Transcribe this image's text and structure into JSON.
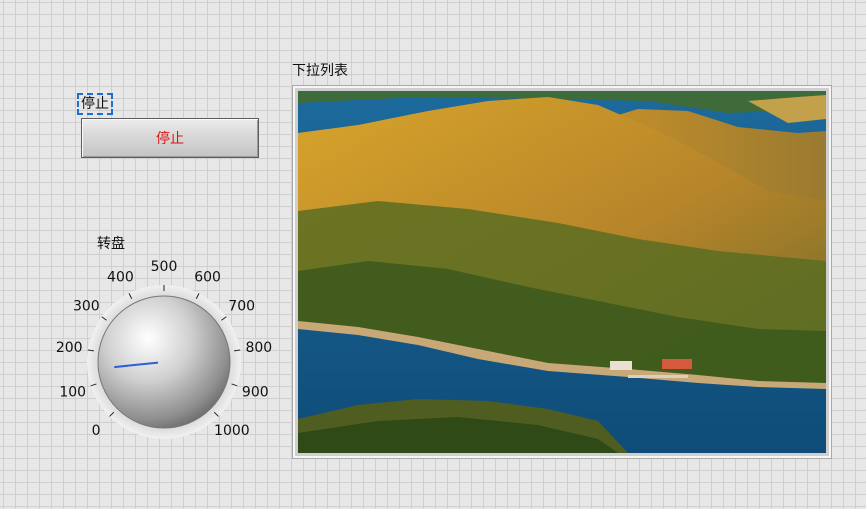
{
  "stop_control": {
    "label": "停止",
    "button_text": "停止",
    "text_color": "#e01313"
  },
  "knob": {
    "label": "转盘",
    "min": 0,
    "max": 1000,
    "value": 145,
    "scale_labels": [
      "0",
      "100",
      "200",
      "300",
      "400",
      "500",
      "600",
      "700",
      "800",
      "900",
      "1000"
    ],
    "needle_color": "#2c5fd8"
  },
  "picture": {
    "label": "下拉列表",
    "description_icon": "landscape-photo"
  }
}
